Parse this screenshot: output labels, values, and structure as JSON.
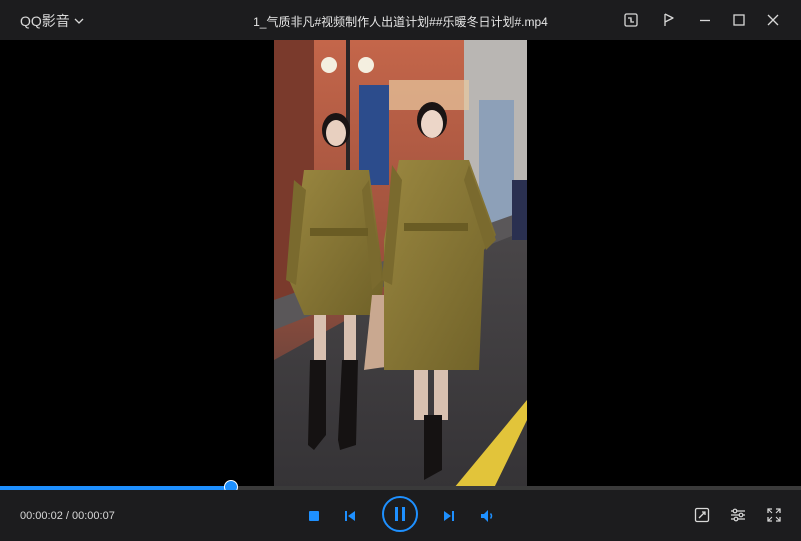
{
  "app": {
    "name": "QQ影音"
  },
  "window": {
    "title": "1_气质非凡#视频制作人出道计划##乐暖冬日计划#.mp4"
  },
  "playback": {
    "time_display": "00:00:02 / 00:00:07",
    "progress_fraction": 0.288,
    "state": "playing"
  },
  "colors": {
    "accent": "#1e90ff",
    "bar": "#1c1c1e",
    "background": "#000000",
    "coat": "#8a7a3a"
  },
  "icons": {
    "app_menu": "chevron-down-icon",
    "screenshot": "screenshot-icon",
    "pin": "pin-icon",
    "minimize": "minimize-icon",
    "maximize": "maximize-icon",
    "close": "close-icon",
    "stop": "stop-icon",
    "previous": "previous-icon",
    "pause": "pause-icon",
    "next": "next-icon",
    "volume": "volume-icon",
    "capture": "capture-icon",
    "settings": "settings-sliders-icon",
    "fullscreen": "fullscreen-icon"
  }
}
